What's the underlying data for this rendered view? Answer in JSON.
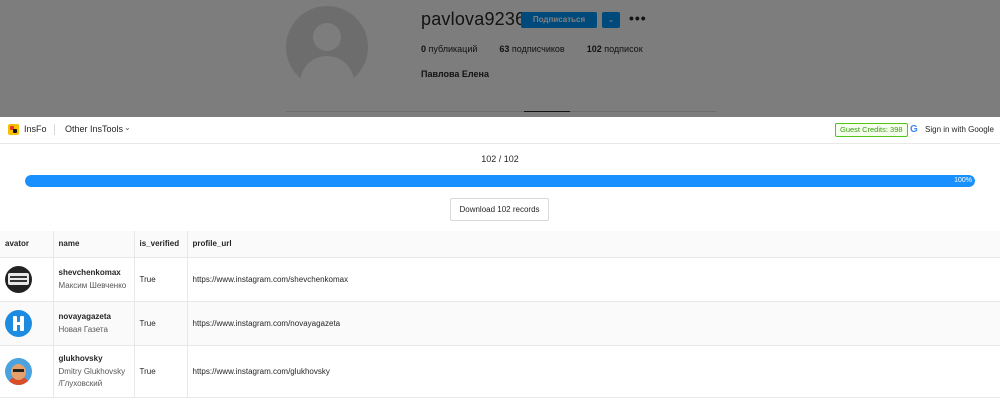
{
  "instagram": {
    "username": "pavlova9236",
    "follow_label": "Подписаться",
    "more_label": "•••",
    "stats": [
      {
        "count": "0",
        "label": "публикаций"
      },
      {
        "count": "63",
        "label": "подписчиков"
      },
      {
        "count": "102",
        "label": "подписок"
      }
    ],
    "full_name": "Павлова Елена"
  },
  "header": {
    "logo_text": "InsFo",
    "other_tools_label": "Other InsTools",
    "credits_label": "Guest Credits: 398",
    "google_icon_glyph": "G",
    "signin_label": "Sign in with Google"
  },
  "progress": {
    "count_text": "102 / 102",
    "percent": 100,
    "percent_label": "100%",
    "bar_color": "#1890ff"
  },
  "download_label": "Download 102 records",
  "table": {
    "columns": [
      "avator",
      "name",
      "is_verified",
      "profile_url"
    ],
    "rows": [
      {
        "avatar_icon": "svobodnoe-mnenie-avatar",
        "username": "shevchenkomax",
        "full_name": "Максим Шевченко",
        "is_verified": "True",
        "profile_url": "https://www.instagram.com/shevchenkomax"
      },
      {
        "avatar_icon": "novaya-gazeta-logo-avatar",
        "username": "novayagazeta",
        "full_name": "Новая Газета",
        "is_verified": "True",
        "profile_url": "https://www.instagram.com/novayagazeta"
      },
      {
        "avatar_icon": "portrait-avatar",
        "username": "glukhovsky",
        "full_name": "Dmitry Glukhovsky /Глуховский",
        "is_verified": "True",
        "profile_url": "https://www.instagram.com/glukhovsky"
      }
    ]
  }
}
